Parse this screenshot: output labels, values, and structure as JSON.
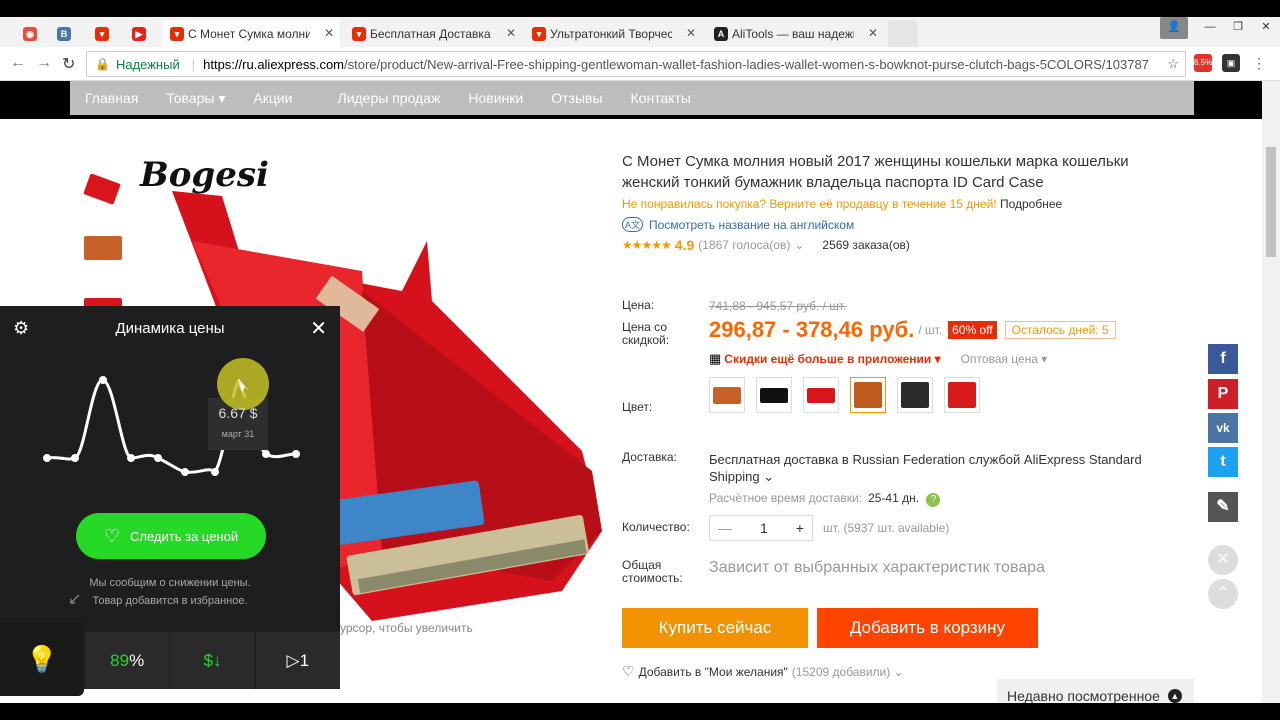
{
  "browser": {
    "tabs": [
      {
        "title": "",
        "icon": "generic-icon",
        "color": "#e74c3c"
      },
      {
        "title": "",
        "icon": "vk-icon",
        "color": "#4a76a8"
      },
      {
        "title": "",
        "icon": "aliexpress-icon",
        "color": "#e62e04"
      },
      {
        "title": "",
        "icon": "youtube-icon",
        "color": "#e62117"
      },
      {
        "title": "С Монет Сумка молния",
        "icon": "aliexpress-icon",
        "color": "#e62e04",
        "active": true
      },
      {
        "title": "Бесплатная Доставка Ку",
        "icon": "aliexpress-icon",
        "color": "#e62e04"
      },
      {
        "title": "Ультратонкий Творческ",
        "icon": "aliexpress-icon",
        "color": "#e62e04"
      },
      {
        "title": "AliTools — ваш надежн",
        "icon": "alitools-icon",
        "color": "#222222"
      }
    ],
    "secure_label": "Надежный",
    "url_host": "https://ru.aliexpress.com",
    "url_path": "/store/product/New-arrival-Free-shipping-gentlewoman-wallet-fashion-ladies-wallet-women-s-bowknot-purse-clutch-bags-5COLORS/103787",
    "ext_badge": "8.5%"
  },
  "nav": {
    "items": [
      "Главная",
      "Товары ▾",
      "Акции",
      "Лидеры продаж",
      "Новинки",
      "Отзывы",
      "Контакты"
    ]
  },
  "gallery": {
    "brand": "Bogesi",
    "zoom_hint": "урсор, чтобы увеличить"
  },
  "product": {
    "title": "С Монет Сумка молния новый 2017 женщины кошельки марка кошельки женский тонкий бумажник владельца паспорта ID Card Case",
    "returns_text": "Не понравилась покупка? Верните её продавцу в течение 15 дней!",
    "returns_more": "Подробнее",
    "translate_badge": "A文",
    "translate_label": "Посмотреть название на английском",
    "stars": "★★★★★",
    "rating": "4.9",
    "votes": "(1867 голоса(ов)",
    "orders": "2569 заказа(ов)",
    "price_label": "Цена:",
    "old_price": "741,88 - 945,57 руб. / шт.",
    "discount_label": "Цена со скидкой:",
    "price": "296,87 - 378,46 руб.",
    "price_unit": "/ шт.",
    "off_badge": "60% off",
    "days_left": "Осталось дней: 5",
    "app_discount": "Скидки ещё больше в приложении ▾",
    "wholesale": "Оптовая цена ▾",
    "color_label": "Цвет:",
    "colors": [
      "#c8602a",
      "#111111",
      "#d9141b",
      "#c05a1e",
      "#2b2b2b",
      "#d71a1a"
    ],
    "delivery_label": "Доставка:",
    "delivery_text": "Бесплатная доставка в Russian Federation службой AliExpress Standard Shipping ⌄",
    "delivery_time_label": "Расчётное время доставки:",
    "delivery_time": "25-41 дн.",
    "qty_label": "Количество:",
    "qty_minus": "—",
    "qty_value": "1",
    "qty_plus": "+",
    "qty_note": "шт. (5937 шт. available)",
    "total_label": "Общая стоимость:",
    "total_text": "Зависит от выбранных характеристик товара",
    "buy_now": "Купить сейчас",
    "add_cart": "Добавить в корзину",
    "wish_text": "Добавить в \"Мои желания\"",
    "wish_count": "(15209 добавили) ⌄"
  },
  "recent": {
    "label": "Недавно посмотренное"
  },
  "share": [
    {
      "icon": "facebook-icon",
      "glyph": "f",
      "color": "#3b5998"
    },
    {
      "icon": "pinterest-icon",
      "glyph": "P",
      "color": "#cb2027"
    },
    {
      "icon": "vk-icon",
      "glyph": "vk",
      "color": "#4c75a3"
    },
    {
      "icon": "twitter-icon",
      "glyph": "t",
      "color": "#1da1f2"
    },
    {
      "icon": "edit-icon",
      "glyph": "✎",
      "color": "#555555"
    }
  ],
  "widget": {
    "title": "Динамика цены",
    "tooltip_price": "6.67 $",
    "tooltip_date": "март 31",
    "follow_label": "Следить за ценой",
    "note_line1": "Мы сообщим о снижении цены.",
    "note_line2": "Товар добавится в избранное.",
    "stat_percent": "89",
    "stat_percent_sign": "%",
    "stat_price": "$↓",
    "stat_play": "▷1"
  }
}
